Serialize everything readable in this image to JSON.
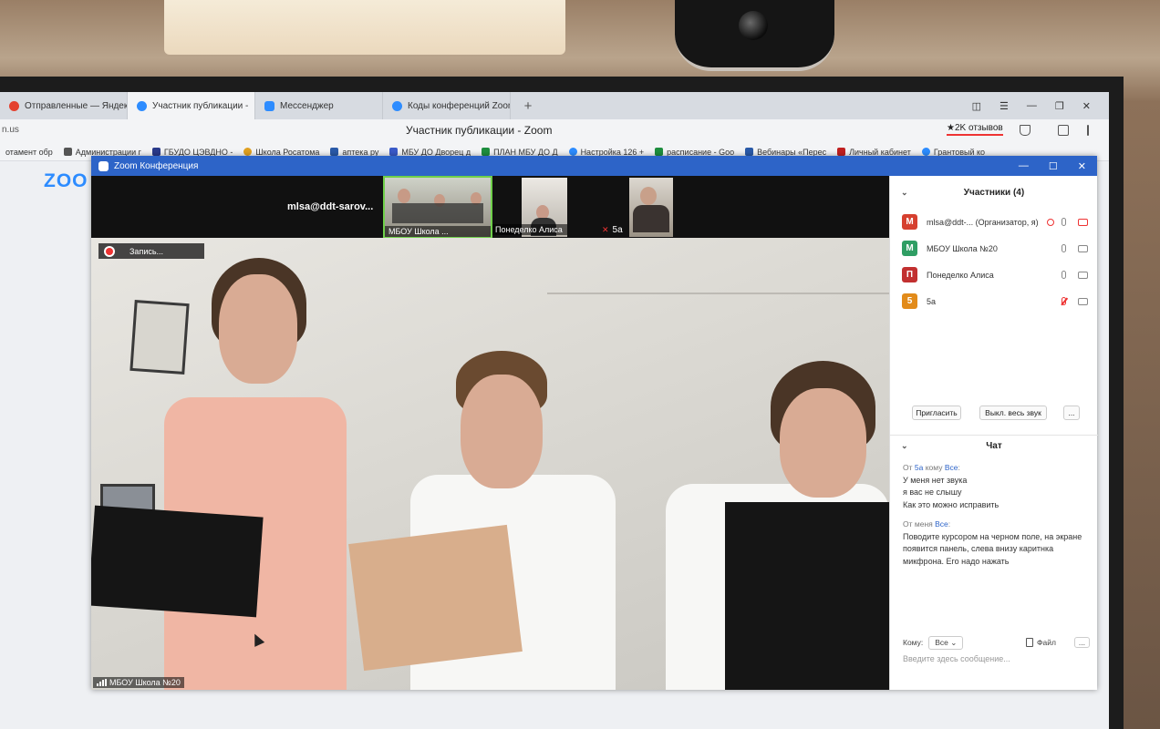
{
  "browser": {
    "tabs": [
      {
        "label": "Отправленные — Яндекс"
      },
      {
        "label": "Участник публикации -"
      },
      {
        "label": "Мессенджер"
      },
      {
        "label": "Коды конференций Zoom"
      }
    ],
    "url_host": "n.us",
    "page_title": "Участник публикации - Zoom",
    "reviews": "★2K отзывов",
    "bookmarks": [
      "отамент обр",
      "Администрации г",
      "ГБУДО ЦЭВДНО -",
      "Школа Росатома",
      "аптека ру",
      "МБУ ДО Дворец д",
      "ПЛАН МБУ ДО Д",
      "Настройка 126 +",
      "расписание - Goo",
      "Вебинары «Перес",
      "Личный кабинет",
      "Грантовый ко"
    ],
    "background_logo": "ZOO"
  },
  "zoom": {
    "window_title": "Zoom Конференция",
    "strip_name": "mlsa@ddt-sarov...",
    "thumbnails": [
      {
        "caption": "МБОУ Школа ..."
      },
      {
        "caption": "Понеделко Алиса"
      },
      {
        "caption": "5a"
      }
    ],
    "recording_label": "Запись...",
    "main_speaker": "МБОУ Школа №20"
  },
  "participants": {
    "header": "Участники (4)",
    "list": [
      {
        "initial": "M",
        "name": "mlsa@ddt-... (Организатор, я)",
        "color": "#d6402f"
      },
      {
        "initial": "M",
        "name": "МБОУ Школа №20",
        "color": "#2f9e64"
      },
      {
        "initial": "П",
        "name": "Понеделко Алиса",
        "color": "#c23030"
      },
      {
        "initial": "5",
        "name": "5a",
        "color": "#e28b1a"
      }
    ],
    "invite_label": "Пригласить",
    "mute_all_label": "Выкл. весь звук",
    "more_label": "..."
  },
  "chat": {
    "header": "Чат",
    "messages": [
      {
        "prefix": "От",
        "from": "5a",
        "mid": "кому",
        "to": "Все",
        "suffix": ":",
        "lines": [
          "У меня нет звука",
          "я вас не слышу",
          "Как это можно исправить"
        ]
      },
      {
        "prefix": "От",
        "from": "меня",
        "mid": "",
        "to": "Все",
        "suffix": ":",
        "lines": [
          "Поводите курсором на черном поле, на экране появится панель, слева внизу каритнка микфрона. Его надо нажать"
        ]
      }
    ],
    "to_label": "Кому:",
    "to_value": "Все",
    "file_label": "Файл",
    "more_label": "...",
    "input_placeholder": "Введите здесь сообщение..."
  }
}
